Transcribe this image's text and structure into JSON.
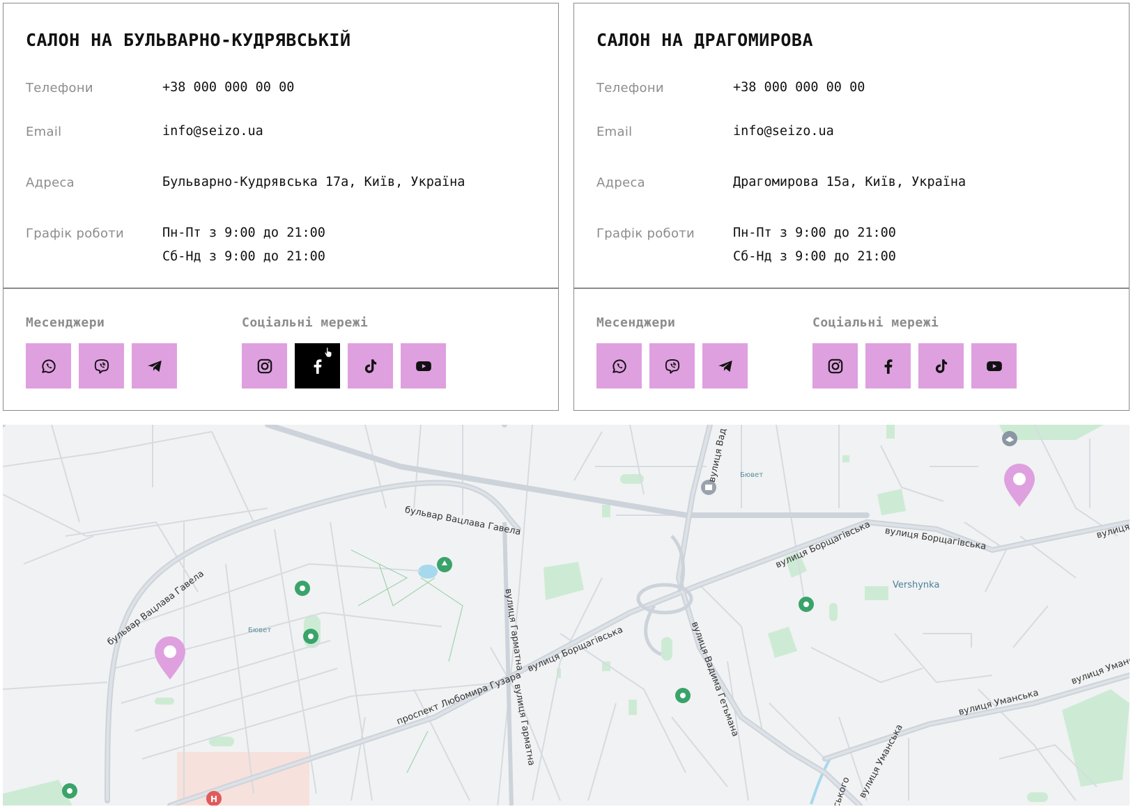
{
  "salons": [
    {
      "title": "САЛОН НА БУЛЬВАРНО-КУДРЯВСЬКІЙ",
      "phone_label": "Телефони",
      "phone": "+38 000 000 00 00",
      "email_label": "Email",
      "email": "info@seizo.ua",
      "address_label": "Адреса",
      "address": "Бульварно-Кудрявська 17а, Київ, Україна",
      "hours_label": "Графік роботи",
      "hours_weekdays": "Пн-Пт з 9:00 до 21:00",
      "hours_weekend": "Сб-Нд з 9:00 до 21:00",
      "messengers_label": "Месенджери",
      "social_label": "Соціальні мережі"
    },
    {
      "title": "САЛОН НА ДРАГОМИРОВА",
      "phone_label": "Телефони",
      "phone": "+38 000 000 00 00",
      "email_label": "Email",
      "email": "info@seizo.ua",
      "address_label": "Адреса",
      "address": "Драгомирова 15а, Київ, Україна",
      "hours_label": "Графік роботи",
      "hours_weekdays": "Пн-Пт з 9:00 до 21:00",
      "hours_weekend": "Сб-Нд з 9:00 до 21:00",
      "messengers_label": "Месенджери",
      "social_label": "Соціальні мережі"
    }
  ],
  "icons": {
    "messengers": [
      "whatsapp-icon",
      "viber-icon",
      "telegram-icon"
    ],
    "social": [
      "instagram-icon",
      "facebook-icon",
      "tiktok-icon",
      "youtube-icon"
    ],
    "hovered": "facebook-icon (left card)"
  },
  "colors": {
    "icon_bg": "#dfa0df",
    "icon_bg_active": "#000000",
    "pin": "#dfa0df",
    "border": "#8a8a8a",
    "label_gray": "#8c8c8c"
  },
  "map": {
    "streets": {
      "havel_1": "бульвар Вацлава Гавела",
      "havel_2": "бульвар Вацлава Гавела",
      "borsch_1": "вулиця Борщагівська",
      "borsch_2": "вулиця Борщагівська",
      "borsch_3": "вулиця Борщагівська",
      "borsch_4": "вулиця Борщагівська",
      "huzar": "проспект Любомира Гузара",
      "harmatna_1": "вулиця Гарматна",
      "harmatna_2": "вулиця Гарматна",
      "hetman": "вулиця Вадима Гетьмана",
      "vad": "вулиця Вад",
      "umanska_1": "вулиця Уманська",
      "umanska_2": "вулиця Уманська",
      "umanska_3": "вулиця Уманс",
      "borsch_end": "вулиця",
      "skoho": "ського"
    },
    "places": {
      "biuvet_1": "Бювет",
      "biuvet_2": "Бювет",
      "vershynka": "Vershynka"
    }
  }
}
